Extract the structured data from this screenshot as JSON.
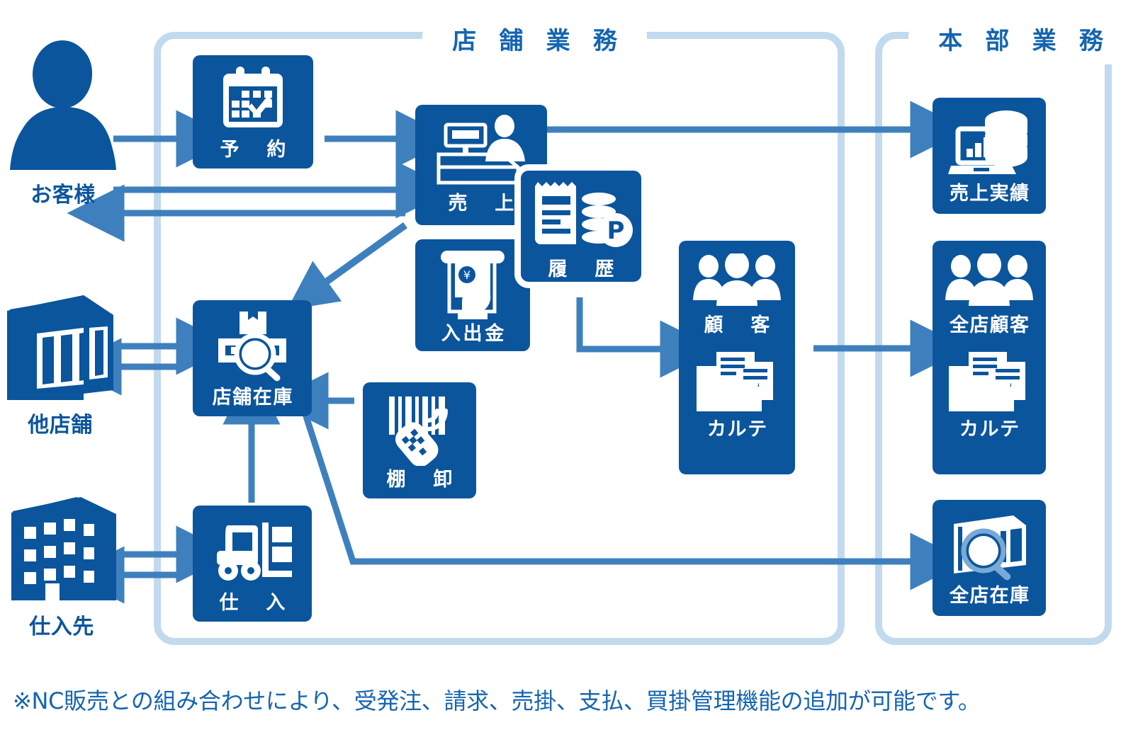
{
  "diagram": {
    "title_store": "店 舗 業 務",
    "title_hq": "本 部 業 務",
    "footnote": "※NC販売との組み合わせにより、受発注、請求、売掛、支払、買掛管理機能の追加が可能です。",
    "colors": {
      "card_fill": "#0b559c",
      "frame_stroke": "#c2daee",
      "arrow": "#3e80bd",
      "actor_fill": "#0b559c",
      "title_text": "#1565b0",
      "label_text": "#ffffff",
      "page_bg": "#ffffff"
    }
  },
  "actors": [
    {
      "id": "customer",
      "label": "お客様",
      "icon": "person-icon"
    },
    {
      "id": "otherstore",
      "label": "他店舗",
      "icon": "storefront-icon"
    },
    {
      "id": "supplier",
      "label": "仕入先",
      "icon": "office-building-icon"
    }
  ],
  "store_cards": [
    {
      "id": "reservation",
      "label": "予　約",
      "icon": "calendar-check-icon"
    },
    {
      "id": "sales",
      "label": "売　上",
      "icon": "cash-register-icon"
    },
    {
      "id": "cashflow",
      "label": "入出金",
      "icon": "atm-hand-cash-icon"
    },
    {
      "id": "history",
      "label": "履　歴",
      "icon": "receipt-coins-point-icon"
    },
    {
      "id": "storestock",
      "label": "店舗在庫",
      "icon": "box-magnifier-icon"
    },
    {
      "id": "stocktake",
      "label": "棚　卸",
      "icon": "barcode-scanner-icon"
    },
    {
      "id": "purchase",
      "label": "仕　入",
      "icon": "forklift-icon"
    },
    {
      "id": "customerdb",
      "label": "顧　客",
      "icon": "three-people-icon"
    },
    {
      "id": "karte",
      "label": "カルテ",
      "icon": "folder-documents-icon"
    }
  ],
  "hq_cards": [
    {
      "id": "salesresult",
      "label": "売上実績",
      "icon": "laptop-chart-coins-icon"
    },
    {
      "id": "allcustomer",
      "label": "全店顧客",
      "icon": "three-people-icon"
    },
    {
      "id": "allkarte",
      "label": "カルテ",
      "icon": "folder-documents-icon"
    },
    {
      "id": "allstock",
      "label": "全店在庫",
      "icon": "store-magnifier-icon"
    }
  ],
  "connections": [
    {
      "from": "customer",
      "to": "reservation",
      "style": "arrow-right"
    },
    {
      "from": "customer",
      "to": "sales",
      "style": "arrow-right"
    },
    {
      "from": "sales",
      "to": "customer",
      "style": "arrow-left"
    },
    {
      "from": "reservation",
      "to": "sales",
      "style": "arrow-right"
    },
    {
      "from": "sales",
      "to": "salesresult",
      "style": "arrow-right-long"
    },
    {
      "from": "sales",
      "to": "storestock",
      "style": "arrow-diagonal-down-left"
    },
    {
      "from": "otherstore",
      "to": "storestock",
      "style": "arrow-right"
    },
    {
      "from": "storestock",
      "to": "otherstore",
      "style": "arrow-left"
    },
    {
      "from": "stocktake",
      "to": "storestock",
      "style": "arrow-left"
    },
    {
      "from": "purchase",
      "to": "storestock",
      "style": "arrow-up"
    },
    {
      "from": "supplier",
      "to": "purchase",
      "style": "arrow-right"
    },
    {
      "from": "purchase",
      "to": "supplier",
      "style": "arrow-left"
    },
    {
      "from": "history",
      "to": "customerdb",
      "style": "elbow-down-right"
    },
    {
      "from": "customerdb",
      "to": "allcustomer",
      "style": "arrow-right"
    },
    {
      "from": "storestock",
      "to": "allstock",
      "style": "elbow-diagonal-right"
    }
  ]
}
